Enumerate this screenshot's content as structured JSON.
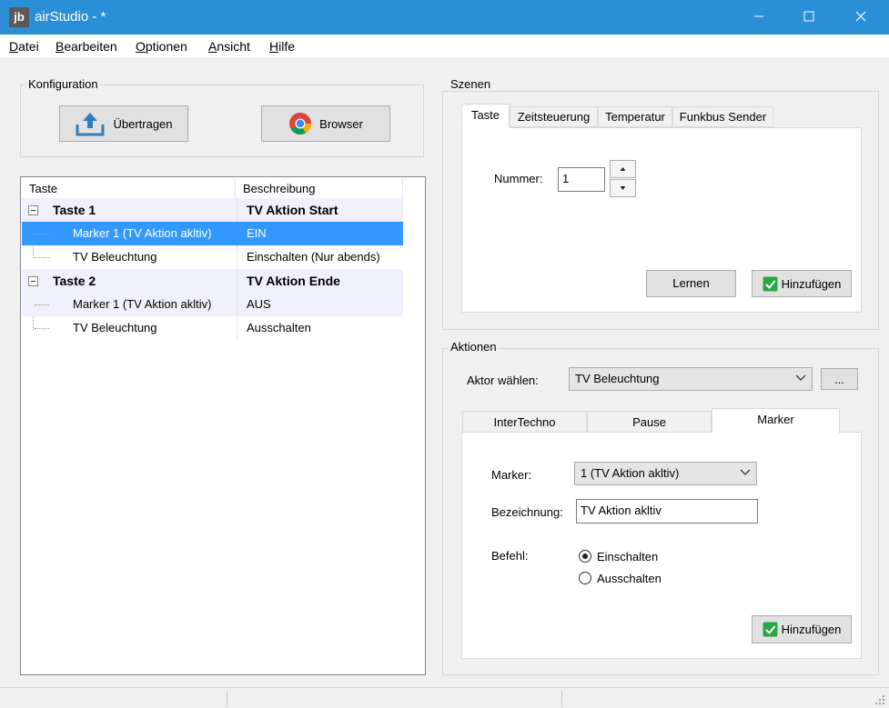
{
  "window": {
    "logo": "jb",
    "title": "airStudio -  *",
    "controls": {
      "minimize_icon": "minimize-icon",
      "maximize_icon": "maximize-icon",
      "close_icon": "close-icon"
    }
  },
  "menu": {
    "items": [
      {
        "label": "Datei",
        "accelerator": "D",
        "rest": "atei"
      },
      {
        "label": "Bearbeiten",
        "accelerator": "B",
        "rest": "earbeiten"
      },
      {
        "label": "Optionen",
        "accelerator": "O",
        "rest": "ptionen"
      },
      {
        "label": "Ansicht",
        "accelerator": "A",
        "rest": "nsicht"
      },
      {
        "label": "Hilfe",
        "accelerator": "H",
        "rest": "ilfe"
      }
    ]
  },
  "konfiguration": {
    "title": "Konfiguration",
    "upload_button": {
      "label": "Übertragen",
      "icon": "upload-icon"
    },
    "browser_button": {
      "label": "Browser",
      "icon": "chrome-icon"
    }
  },
  "tree": {
    "columns": [
      "Taste",
      "Beschreibung"
    ],
    "rows": [
      {
        "type": "group",
        "name": "Taste 1",
        "description": "TV Aktion Start"
      },
      {
        "type": "child",
        "name": "Marker 1 (TV Aktion akltiv)",
        "description": "EIN",
        "selected": true
      },
      {
        "type": "child",
        "name": "TV Beleuchtung",
        "description": "Einschalten (Nur abends)"
      },
      {
        "type": "group",
        "name": "Taste 2",
        "description": "TV Aktion Ende"
      },
      {
        "type": "child",
        "name": "Marker 1 (TV Aktion akltiv)",
        "description": "AUS"
      },
      {
        "type": "child",
        "name": "TV Beleuchtung",
        "description": "Ausschalten"
      }
    ]
  },
  "szenen": {
    "title": "Szenen",
    "tabs": [
      "Taste",
      "Zeitsteuerung",
      "Temperatur",
      "Funkbus Sender"
    ],
    "active_tab": "Taste",
    "nummer_label": "Nummer:",
    "nummer_value": "1",
    "lernen_button": "Lernen",
    "hinzufuegen_button": "Hinzufügen"
  },
  "aktionen": {
    "title": "Aktionen",
    "aktor_label": "Aktor wählen:",
    "aktor_value": "TV Beleuchtung",
    "ellipsis_button": "...",
    "tabs": [
      "InterTechno",
      "Pause",
      "Marker"
    ],
    "active_tab": "Marker",
    "marker_label": "Marker:",
    "marker_value": "1 (TV Aktion akltiv)",
    "bezeichnung_label": "Bezeichnung:",
    "bezeichnung_value": "TV Aktion akltiv",
    "befehl_label": "Befehl:",
    "befehl_options": [
      {
        "label": "Einschalten",
        "checked": true
      },
      {
        "label": "Ausschalten",
        "checked": false
      }
    ],
    "hinzufuegen_button": "Hinzufügen"
  },
  "colors": {
    "titlebar": "#2b8fd8",
    "selection": "#3399ff",
    "row_alt": "#eff0fb",
    "check_green": "#28a745"
  }
}
